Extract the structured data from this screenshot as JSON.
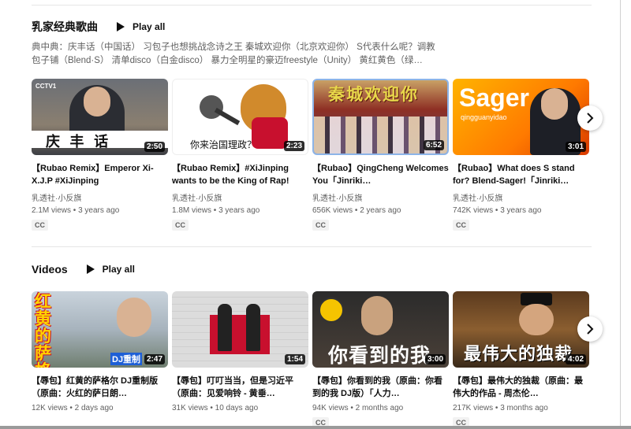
{
  "sections": [
    {
      "title": "乳家经典歌曲",
      "play_all": "Play all",
      "description": "典中典：庆丰话（中国话） 习包子也想挑战念诗之王 秦城欢迎你（北京欢迎你） S代表什么呢？调教包子铺（Blend·S） 清单disco（白金disco） 暴力全明星的豪迈freestyle（Unity） 黄红黄色（绿…",
      "videos": [
        {
          "title": "【Rubao Remix】Emperor Xi-X.J.P #XiJinping",
          "channel": "乳透社·小反旗",
          "views": "2.1M views",
          "age": "3 years ago",
          "duration": "2:50",
          "badge": "CC",
          "thumb_caption": "庆  丰  话",
          "thumb_logo": "CCTV1"
        },
        {
          "title": "【Rubao Remix】#XiJinping wants to be the King of Rap!",
          "channel": "乳透社·小反旗",
          "views": "1.8M views",
          "age": "3 years ago",
          "duration": "2:23",
          "badge": "CC",
          "thumb_caption": "你来治国理政？"
        },
        {
          "title": "【Rubao】QingCheng Welcomes You「Jinriki…",
          "channel": "乳透社·小反旗",
          "views": "656K views",
          "age": "2 years ago",
          "duration": "6:52",
          "badge": "CC",
          "thumb_caption": "秦城欢迎你"
        },
        {
          "title": "【Rubao】What does S stand for? Blend-Sager!「Jinriki…",
          "channel": "乳透社·小反旗",
          "views": "742K views",
          "age": "3 years ago",
          "duration": "3:01",
          "badge": "CC",
          "thumb_caption": "Sager",
          "thumb_sub": "qingguanyidao"
        }
      ]
    },
    {
      "title": "Videos",
      "play_all": "Play all",
      "videos": [
        {
          "title": "【辱包】红黄的萨格尔 DJ重制版（原曲：火红的萨日朗…",
          "views": "12K views",
          "age": "2 days ago",
          "duration": "2:47",
          "thumb_caption": "红黄的萨格尔",
          "thumb_sub": "DJ重制"
        },
        {
          "title": "【辱包】叮叮当当，但是习近平（原曲：见爱响铃 - 黄垂…",
          "views": "31K views",
          "age": "10 days ago",
          "duration": "1:54"
        },
        {
          "title": "【辱包】你看到的我（原曲：你看到的我 DJ版）「人力…",
          "views": "94K views",
          "age": "2 months ago",
          "duration": "3:00",
          "badge": "CC",
          "thumb_caption": "你看到的我"
        },
        {
          "title": "【辱包】最伟大的独裁（原曲：最伟大的作品 - 周杰伦…",
          "views": "217K views",
          "age": "3 months ago",
          "duration": "4:02",
          "badge": "CC",
          "thumb_caption": "最伟大的独裁"
        }
      ]
    }
  ],
  "colors": {
    "accent_yellow": "#f5c400",
    "thumb_orange": "#ff8a00",
    "thumb_red": "#c8102e"
  },
  "icons": {
    "play": "play-icon",
    "next": "chevron-right-icon"
  }
}
